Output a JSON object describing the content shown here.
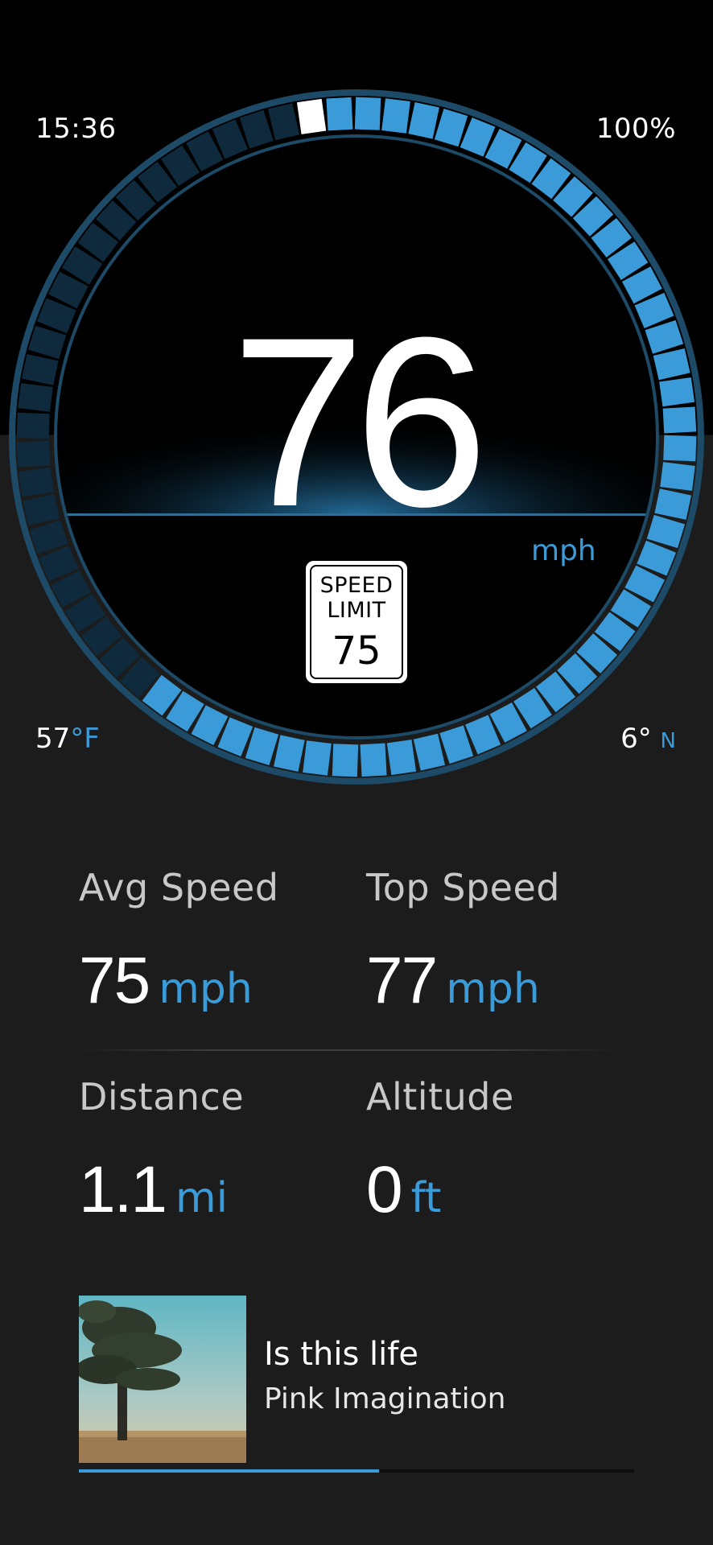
{
  "status": {
    "time": "15:36",
    "battery": "100%"
  },
  "weather": {
    "temp_value": "57",
    "temp_unit": "°F"
  },
  "heading": {
    "degrees": "6°",
    "direction": "N"
  },
  "speedometer": {
    "speed": "76",
    "unit": "mph",
    "gauge_fill_fraction": 0.62,
    "colors": {
      "accent": "#3a9bd8",
      "inactive": "#0f2a3c",
      "marker": "#ffffff"
    }
  },
  "speed_limit": {
    "line1": "SPEED",
    "line2": "LIMIT",
    "value": "75"
  },
  "stats": {
    "avg_speed": {
      "label": "Avg Speed",
      "value": "75",
      "unit": "mph"
    },
    "top_speed": {
      "label": "Top Speed",
      "value": "77",
      "unit": "mph"
    },
    "distance": {
      "label": "Distance",
      "value": "1.1",
      "unit": "mi"
    },
    "altitude": {
      "label": "Altitude",
      "value": "0",
      "unit": "ft"
    }
  },
  "now_playing": {
    "title": "Is this life",
    "artist": "Pink Imagination",
    "progress_fraction": 0.54
  }
}
